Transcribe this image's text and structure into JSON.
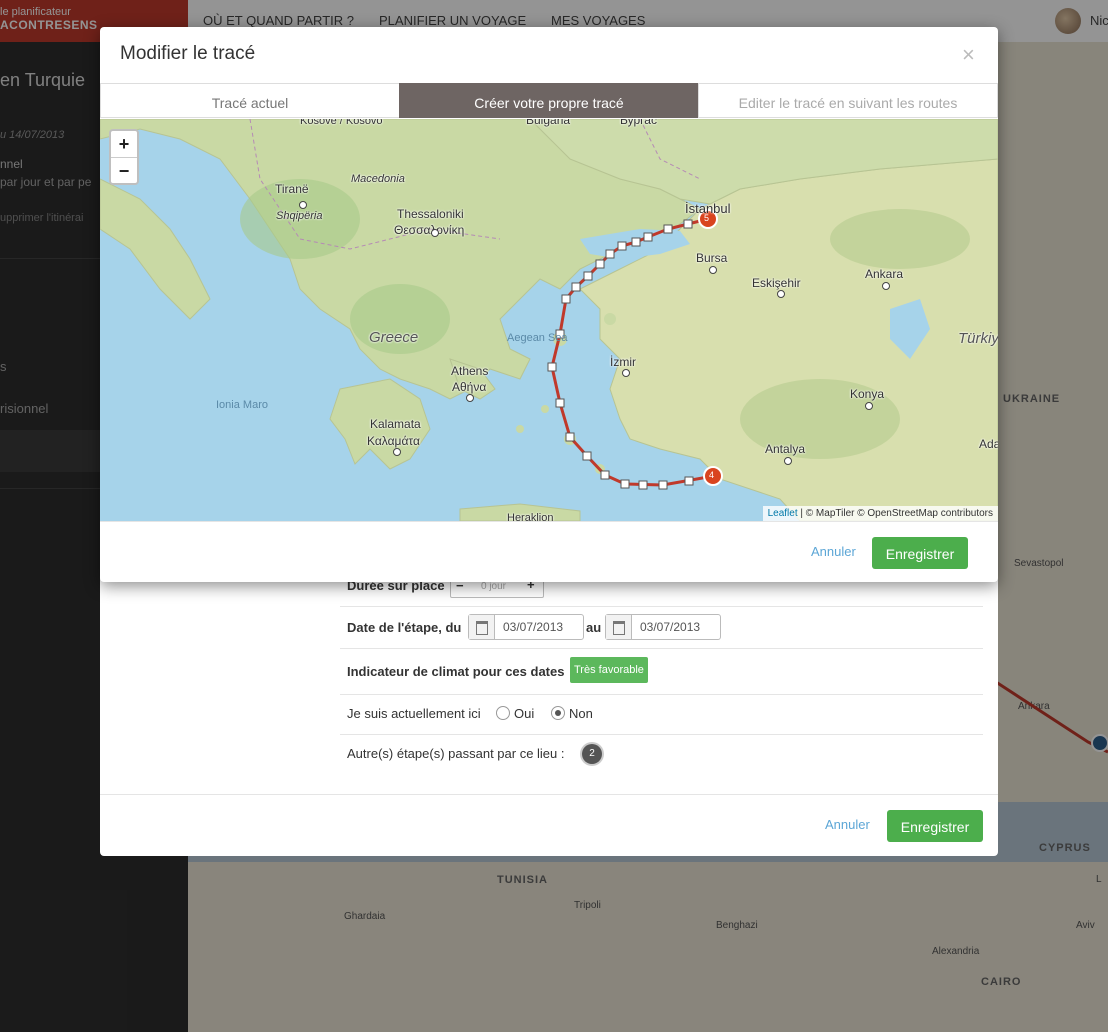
{
  "app": {
    "brand_line1": "le planificateur",
    "brand_line2": "ACONTRESENS"
  },
  "topnav": {
    "items": [
      "OÙ ET QUAND PARTIR ?",
      "PLANIFIER UN VOYAGE",
      "MES VOYAGES"
    ],
    "user": "Nic"
  },
  "sidebar": {
    "title": "en Turquie",
    "date": "u 14/07/2013",
    "t1": "nnel",
    "t2": "par jour et par pe",
    "t3": "upprimer l'itinérai",
    "t4": "s",
    "t5": "risionnel"
  },
  "bgmap": {
    "labels": [
      "Sevastopol",
      "UKRAINE",
      "Ankara",
      "CYPRUS",
      "TUNISIA",
      "Tripoli",
      "Ghardaia",
      "Benghazi",
      "Alexandria",
      "CAIRO",
      "Aviv",
      "L"
    ]
  },
  "modal": {
    "title": "Modifier le tracé",
    "close": "×",
    "tabs": [
      {
        "label": "Tracé actuel"
      },
      {
        "label": "Créer votre propre tracé"
      },
      {
        "label": "Editer le tracé en suivant les routes"
      }
    ],
    "active_tab": 1,
    "zoom_in": "+",
    "zoom_out": "−",
    "attribution_link": "Leaflet",
    "attribution_rest": "| © MapTiler © OpenStreetMap contributors",
    "cancel": "Annuler",
    "save": "Enregistrer"
  },
  "map": {
    "labels": {
      "kosovo": "Kosove / Kosovo",
      "bulgaria": "Bulgaria",
      "edirne": "Бургас",
      "tirane": "Tiranë",
      "shqiperia": "Shqipëria",
      "macedonia": "Macedonia",
      "thessaloniki": "Thessaloniki",
      "thessaloniki_gr": "Θεσσαλονίκη",
      "istanbul": "İstanbul",
      "bursa": "Bursa",
      "eskisehir": "Eskişehir",
      "ankara": "Ankara",
      "turkiye": "Türkiye",
      "greece": "Greece",
      "aegean": "Aegean Sea",
      "izmir": "İzmir",
      "athens": "Athens",
      "athens_gr": "Αθήνα",
      "ionia": "Ionia Maro",
      "kalamata": "Kalamata",
      "kalamata_gr": "Καλαμάτα",
      "konya": "Konya",
      "antalya": "Antalya",
      "ada": "Ada",
      "heraklion": "Heraklion"
    },
    "markers": [
      "5",
      "4"
    ],
    "route_color": "#c0392b"
  },
  "step_form": {
    "duration_label": "Durée sur place",
    "duration_value": "0 jour",
    "duration_minus": "−",
    "duration_plus": "+",
    "date_label": "Date de l'étape, du",
    "date_from": "03/07/2013",
    "date_au": "au",
    "date_to": "03/07/2013",
    "climate_label": "Indicateur de climat pour ces dates",
    "climate_value": "Très favorable",
    "climate_color": "#5cb85c",
    "here_label": "Je suis actuellement ici",
    "oui": "Oui",
    "non": "Non",
    "here_selected": "Non",
    "other_steps_label": "Autre(s) étape(s) passant par ce lieu :",
    "other_steps_count": "2",
    "cancel": "Annuler",
    "save": "Enregistrer"
  }
}
